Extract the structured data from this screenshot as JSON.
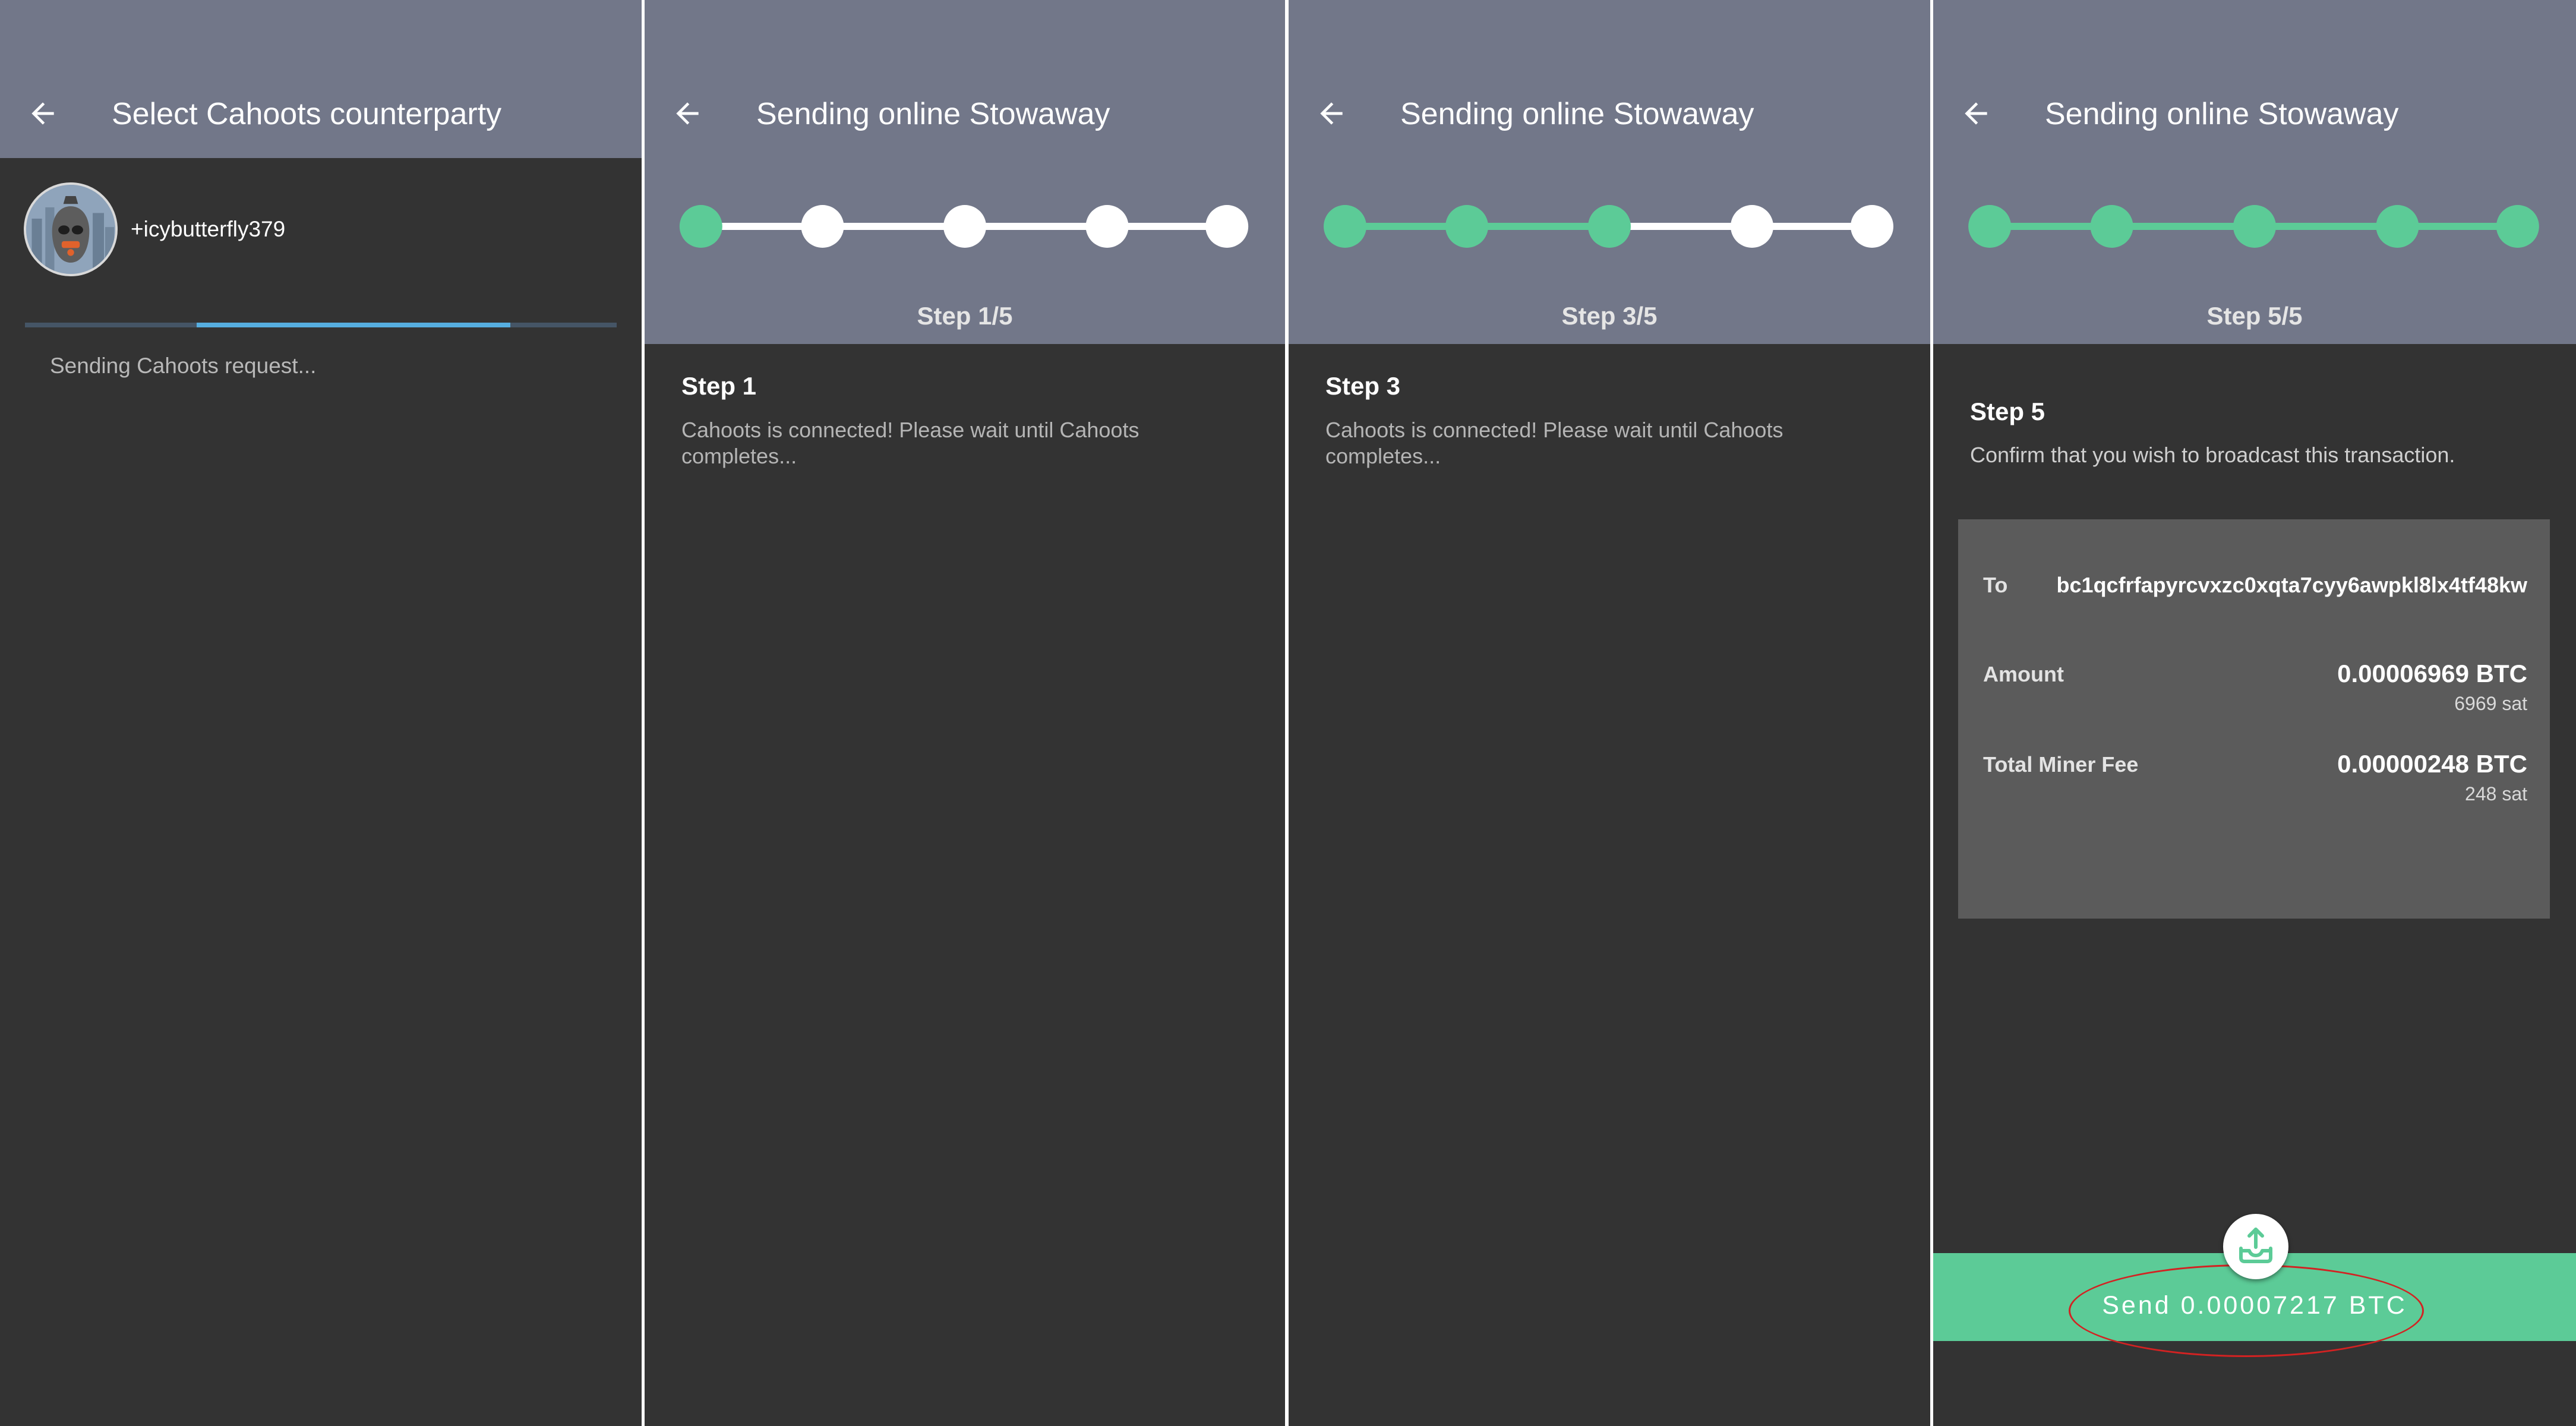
{
  "colors": {
    "toolbar": "#727789",
    "background": "#333333",
    "accent_green": "#5ccb97",
    "progress_blue": "#56aee0",
    "card": "#5b5b5b",
    "highlight_red": "#d32222"
  },
  "screen1": {
    "title": "Select Cahoots counterparty",
    "paynym_name": "+icybutterfly379",
    "status": "Sending Cahoots request...",
    "progress_fraction_start": 0.29,
    "progress_fraction_end": 0.82
  },
  "screen2": {
    "title": "Sending online Stowaway",
    "current_step": 1,
    "total_steps": 5,
    "step_label": "Step 1/5",
    "content_title": "Step 1",
    "content_body": "Cahoots is connected! Please wait until Cahoots completes..."
  },
  "screen3": {
    "title": "Sending online Stowaway",
    "current_step": 3,
    "total_steps": 5,
    "step_label": "Step 3/5",
    "content_title": "Step 3",
    "content_body": "Cahoots is connected! Please wait until Cahoots completes..."
  },
  "screen4": {
    "title": "Sending online Stowaway",
    "current_step": 5,
    "total_steps": 5,
    "step_label": "Step 5/5",
    "content_title": "Step 5",
    "content_body": "Confirm that you wish to broadcast this transaction.",
    "to_label": "To",
    "to_address": "bc1qcfrfapyrcvxzc0xqta7cyy6awpkl8lx4tf48kw",
    "amount_label": "Amount",
    "amount_btc": "0.00006969 BTC",
    "amount_sat": "6969 sat",
    "fee_label": "Total Miner Fee",
    "fee_btc": "0.00000248 BTC",
    "fee_sat": "248 sat",
    "send_label": "Send 0.00007217 BTC",
    "icons": {
      "back": "arrow-left-icon",
      "broadcast": "broadcast-upload-icon"
    }
  }
}
